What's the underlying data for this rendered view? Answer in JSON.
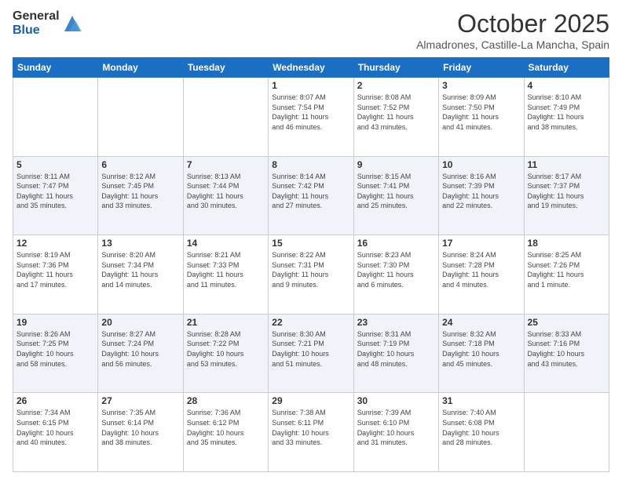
{
  "header": {
    "logo_general": "General",
    "logo_blue": "Blue",
    "month_title": "October 2025",
    "subtitle": "Almadrones, Castille-La Mancha, Spain"
  },
  "calendar": {
    "headers": [
      "Sunday",
      "Monday",
      "Tuesday",
      "Wednesday",
      "Thursday",
      "Friday",
      "Saturday"
    ],
    "weeks": [
      [
        {
          "day": "",
          "info": ""
        },
        {
          "day": "",
          "info": ""
        },
        {
          "day": "",
          "info": ""
        },
        {
          "day": "1",
          "info": "Sunrise: 8:07 AM\nSunset: 7:54 PM\nDaylight: 11 hours\nand 46 minutes."
        },
        {
          "day": "2",
          "info": "Sunrise: 8:08 AM\nSunset: 7:52 PM\nDaylight: 11 hours\nand 43 minutes."
        },
        {
          "day": "3",
          "info": "Sunrise: 8:09 AM\nSunset: 7:50 PM\nDaylight: 11 hours\nand 41 minutes."
        },
        {
          "day": "4",
          "info": "Sunrise: 8:10 AM\nSunset: 7:49 PM\nDaylight: 11 hours\nand 38 minutes."
        }
      ],
      [
        {
          "day": "5",
          "info": "Sunrise: 8:11 AM\nSunset: 7:47 PM\nDaylight: 11 hours\nand 35 minutes."
        },
        {
          "day": "6",
          "info": "Sunrise: 8:12 AM\nSunset: 7:45 PM\nDaylight: 11 hours\nand 33 minutes."
        },
        {
          "day": "7",
          "info": "Sunrise: 8:13 AM\nSunset: 7:44 PM\nDaylight: 11 hours\nand 30 minutes."
        },
        {
          "day": "8",
          "info": "Sunrise: 8:14 AM\nSunset: 7:42 PM\nDaylight: 11 hours\nand 27 minutes."
        },
        {
          "day": "9",
          "info": "Sunrise: 8:15 AM\nSunset: 7:41 PM\nDaylight: 11 hours\nand 25 minutes."
        },
        {
          "day": "10",
          "info": "Sunrise: 8:16 AM\nSunset: 7:39 PM\nDaylight: 11 hours\nand 22 minutes."
        },
        {
          "day": "11",
          "info": "Sunrise: 8:17 AM\nSunset: 7:37 PM\nDaylight: 11 hours\nand 19 minutes."
        }
      ],
      [
        {
          "day": "12",
          "info": "Sunrise: 8:19 AM\nSunset: 7:36 PM\nDaylight: 11 hours\nand 17 minutes."
        },
        {
          "day": "13",
          "info": "Sunrise: 8:20 AM\nSunset: 7:34 PM\nDaylight: 11 hours\nand 14 minutes."
        },
        {
          "day": "14",
          "info": "Sunrise: 8:21 AM\nSunset: 7:33 PM\nDaylight: 11 hours\nand 11 minutes."
        },
        {
          "day": "15",
          "info": "Sunrise: 8:22 AM\nSunset: 7:31 PM\nDaylight: 11 hours\nand 9 minutes."
        },
        {
          "day": "16",
          "info": "Sunrise: 8:23 AM\nSunset: 7:30 PM\nDaylight: 11 hours\nand 6 minutes."
        },
        {
          "day": "17",
          "info": "Sunrise: 8:24 AM\nSunset: 7:28 PM\nDaylight: 11 hours\nand 4 minutes."
        },
        {
          "day": "18",
          "info": "Sunrise: 8:25 AM\nSunset: 7:26 PM\nDaylight: 11 hours\nand 1 minute."
        }
      ],
      [
        {
          "day": "19",
          "info": "Sunrise: 8:26 AM\nSunset: 7:25 PM\nDaylight: 10 hours\nand 58 minutes."
        },
        {
          "day": "20",
          "info": "Sunrise: 8:27 AM\nSunset: 7:24 PM\nDaylight: 10 hours\nand 56 minutes."
        },
        {
          "day": "21",
          "info": "Sunrise: 8:28 AM\nSunset: 7:22 PM\nDaylight: 10 hours\nand 53 minutes."
        },
        {
          "day": "22",
          "info": "Sunrise: 8:30 AM\nSunset: 7:21 PM\nDaylight: 10 hours\nand 51 minutes."
        },
        {
          "day": "23",
          "info": "Sunrise: 8:31 AM\nSunset: 7:19 PM\nDaylight: 10 hours\nand 48 minutes."
        },
        {
          "day": "24",
          "info": "Sunrise: 8:32 AM\nSunset: 7:18 PM\nDaylight: 10 hours\nand 45 minutes."
        },
        {
          "day": "25",
          "info": "Sunrise: 8:33 AM\nSunset: 7:16 PM\nDaylight: 10 hours\nand 43 minutes."
        }
      ],
      [
        {
          "day": "26",
          "info": "Sunrise: 7:34 AM\nSunset: 6:15 PM\nDaylight: 10 hours\nand 40 minutes."
        },
        {
          "day": "27",
          "info": "Sunrise: 7:35 AM\nSunset: 6:14 PM\nDaylight: 10 hours\nand 38 minutes."
        },
        {
          "day": "28",
          "info": "Sunrise: 7:36 AM\nSunset: 6:12 PM\nDaylight: 10 hours\nand 35 minutes."
        },
        {
          "day": "29",
          "info": "Sunrise: 7:38 AM\nSunset: 6:11 PM\nDaylight: 10 hours\nand 33 minutes."
        },
        {
          "day": "30",
          "info": "Sunrise: 7:39 AM\nSunset: 6:10 PM\nDaylight: 10 hours\nand 31 minutes."
        },
        {
          "day": "31",
          "info": "Sunrise: 7:40 AM\nSunset: 6:08 PM\nDaylight: 10 hours\nand 28 minutes."
        },
        {
          "day": "",
          "info": ""
        }
      ]
    ]
  }
}
